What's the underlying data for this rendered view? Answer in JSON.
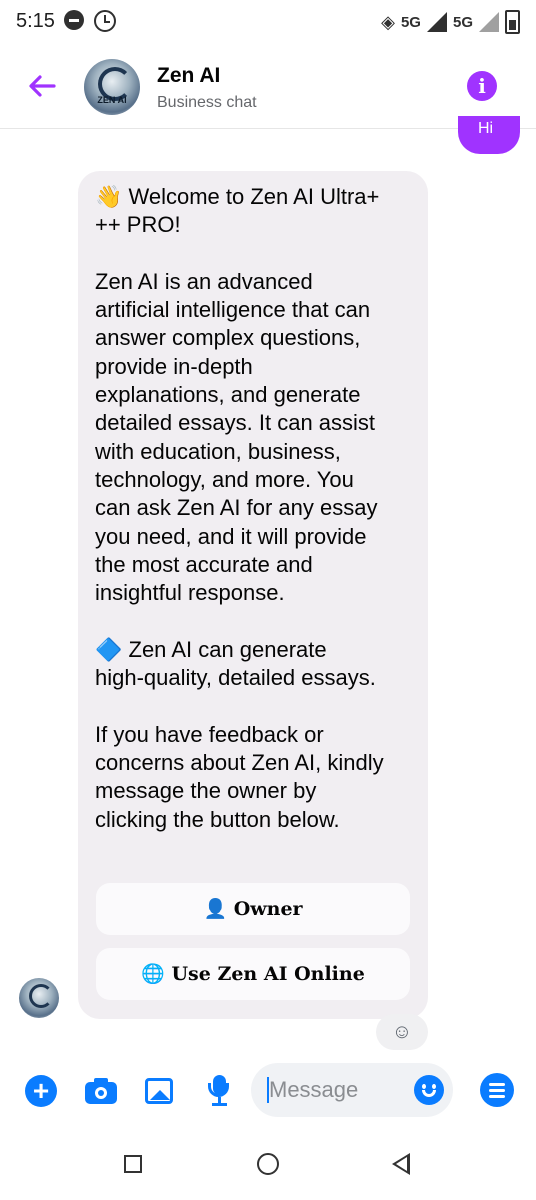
{
  "status_bar": {
    "time": "5:15",
    "network_1": "5G",
    "network_2": "5G",
    "icons": [
      "do-not-disturb-icon",
      "alarm-icon",
      "vpn-key-icon",
      "signal-icon",
      "signal-icon",
      "battery-icon"
    ]
  },
  "header": {
    "title": "Zen AI",
    "subtitle": "Business chat",
    "avatar_text": "ZEN AI",
    "accent_color": "#a033ff"
  },
  "conversation": {
    "welcome_message": "👋 Welcome to Zen AI Ultra+\n++ PRO!\n\nZen AI is an advanced\nartificial intelligence that can\nanswer complex questions,\nprovide in-depth\nexplanations, and generate\ndetailed essays. It can assist\nwith education, business,\ntechnology, and more. You\ncan ask Zen AI for any essay\nyou need, and it will provide\nthe most accurate and\ninsightful response.\n\n🔷 Zen AI can generate\nhigh-quality, detailed essays.\n\nIf you have feedback or\nconcerns about Zen AI, kindly\nmessage the owner by\nclicking the button below.",
    "buttons": [
      {
        "label": "👤 Owner"
      },
      {
        "label": "🌐 Use Zen AI Online"
      }
    ],
    "sender_avatar_text": "ZEN AI"
  },
  "composer": {
    "placeholder": "Message",
    "accent_color": "#0a7cff",
    "icons": [
      "plus-icon",
      "camera-icon",
      "photo-icon",
      "mic-icon",
      "emoji-icon",
      "menu-icon"
    ]
  },
  "navbar": {
    "icons": [
      "recents-icon",
      "home-icon",
      "back-icon"
    ]
  }
}
